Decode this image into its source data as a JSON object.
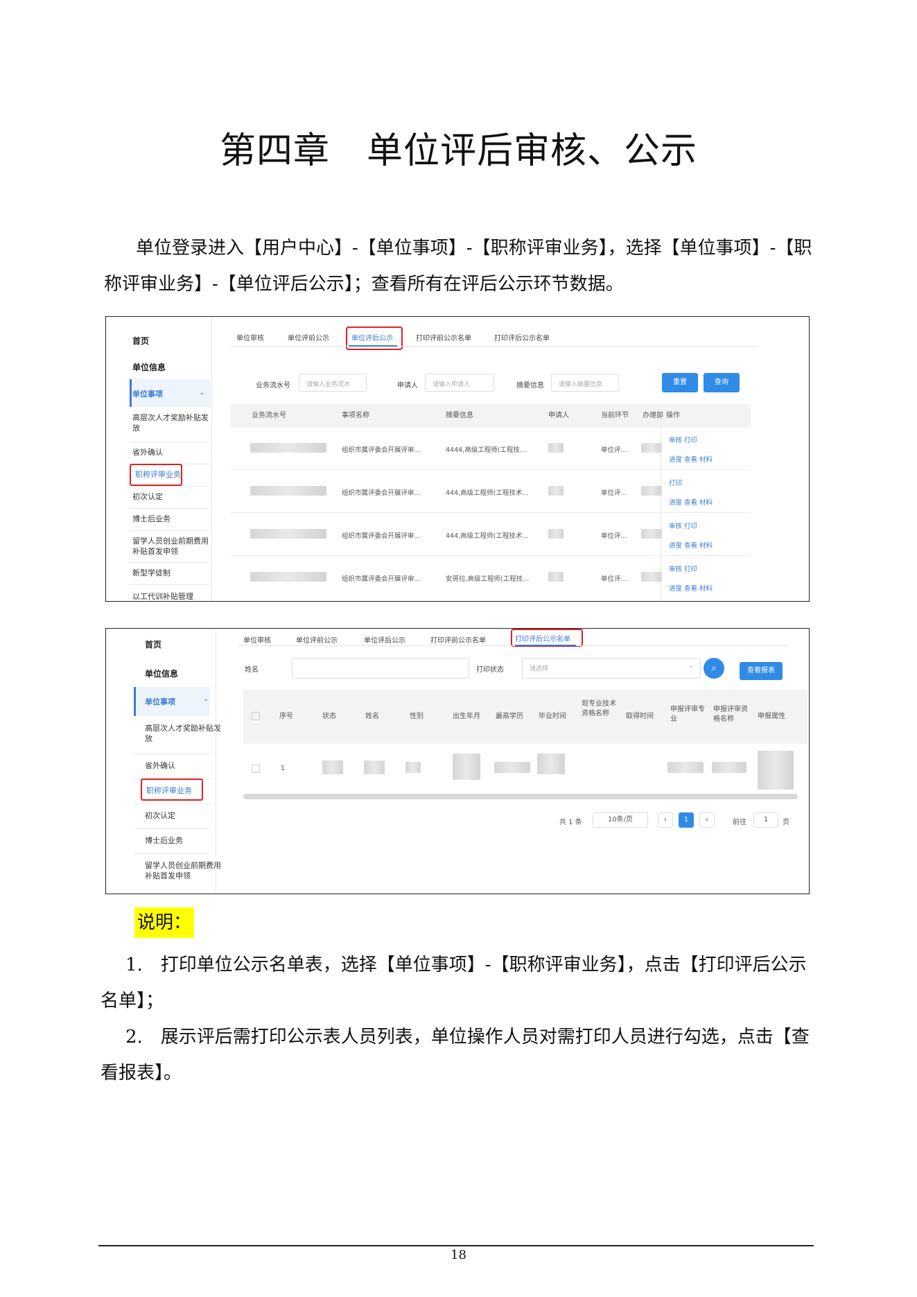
{
  "title": "第四章　单位评后审核、公示",
  "intro": "单位登录进入【用户中心】-【单位事项】-【职称评审业务】，选择【单位事项】-【职称评审业务】-【单位评后公示】；查看所有在评后公示环节数据。",
  "shot1": {
    "sidebar": [
      "首页",
      "单位信息",
      "单位事项",
      "高层次人才奖励补贴发放",
      "省外确认",
      "职称评审业务",
      "初次认定",
      "博士后业务",
      "留学人员创业前期费用补贴首发申领",
      "新型学徒制",
      "以工代训补贴管理"
    ],
    "tabs": [
      "单位审核",
      "单位评前公示",
      "单位评后公示",
      "打印评前公示名单",
      "打印评后公示名单"
    ],
    "filters": {
      "serial_label": "业务流水号",
      "serial_placeholder": "请输入业务流水",
      "applicant_label": "申请人",
      "applicant_placeholder": "请输入申请人",
      "summary_label": "摘要信息",
      "summary_placeholder": "请输入摘要信息",
      "reset": "重置",
      "query": "查询"
    },
    "columns": [
      "业务流水号",
      "事项名称",
      "摘要信息",
      "申请人",
      "当前环节",
      "办理部",
      "操作"
    ],
    "rows": [
      {
        "item": "组织市属评委会开展评审...",
        "summary": "4444,高级工程师(工程技...",
        "step": "单位评...",
        "ops1": "审核  打印",
        "ops2": "进度   查看   材料"
      },
      {
        "item": "组织市属评委会开展评审...",
        "summary": "444,高级工程师(工程技术...",
        "step": "单位评...",
        "ops1": "打印",
        "ops2": "进度   查看   材料"
      },
      {
        "item": "组织市属评委会开展评审...",
        "summary": "444,高级工程师(工程技术...",
        "step": "单位评...",
        "ops1": "审核  打印",
        "ops2": "进度   查看   材料"
      },
      {
        "item": "组织市属评委会开展评审...",
        "summary": "安哥拉,高级工程师(工程技...",
        "step": "单位评...",
        "ops1": "审核  打印",
        "ops2": "进度   查看   材料"
      }
    ]
  },
  "shot2": {
    "sidebar": [
      "首页",
      "单位信息",
      "单位事项",
      "高层次人才奖励补贴发放",
      "省外确认",
      "职称评审业务",
      "初次认定",
      "博士后业务",
      "留学人员创业前期费用补贴首发申领"
    ],
    "tabs": [
      "单位审核",
      "单位评前公示",
      "单位评后公示",
      "打印评前公示名单",
      "打印评后公示名单"
    ],
    "filters": {
      "name_label": "姓名",
      "print_status_label": "打印状态",
      "print_status_placeholder": "请选择",
      "report_button": "查看报表"
    },
    "columns": [
      "序号",
      "状态",
      "姓名",
      "性别",
      "出生年月",
      "最高学历",
      "毕业时间",
      "现专业技术资格名称",
      "取得时间",
      "申报评审专业",
      "申报评审资格名称",
      "申报属性"
    ],
    "row": {
      "index": "1"
    },
    "pagination": {
      "total": "共 1 条",
      "page_size": "10条/页",
      "current": "1",
      "goto_label": "前往",
      "goto_value": "1",
      "page_unit": "页"
    }
  },
  "note_title": "说明：",
  "notes": [
    "1.　打印单位公示名单表，选择【单位事项】-【职称评审业务】，点击【打印评后公示名单】；",
    "2.　展示评后需打印公示表人员列表，单位操作人员对需打印人员进行勾选，点击【查看报表】。"
  ],
  "page_number": "18"
}
